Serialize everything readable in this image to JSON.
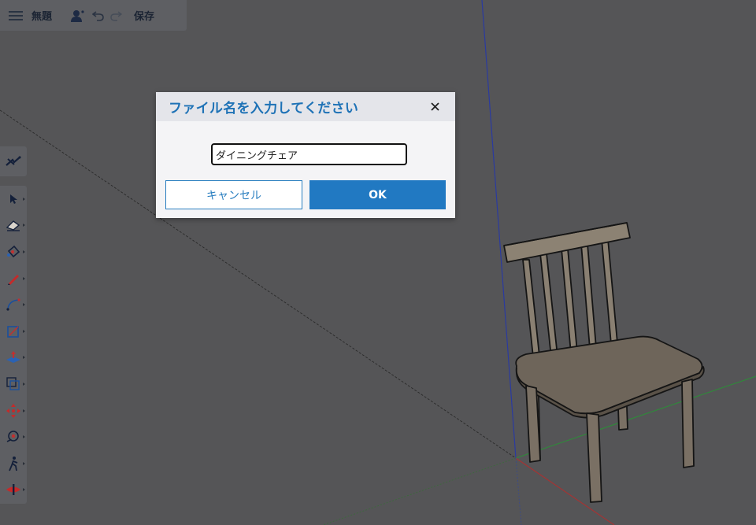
{
  "toolbar": {
    "menu_icon": "hamburger-menu-icon",
    "title": "無題",
    "user_icon": "user-icon",
    "undo_icon": "undo-icon",
    "redo_icon": "redo-icon",
    "save_label": "保存"
  },
  "left_toolbar": {
    "top_tool": "search-warehouse-icon",
    "tools": [
      "select-tool-icon",
      "eraser-tool-icon",
      "paint-bucket-tool-icon",
      "pencil-tool-icon",
      "arc-tool-icon",
      "rectangle-tool-icon",
      "push-pull-tool-icon",
      "offset-tool-icon",
      "move-tool-icon",
      "orbit-tool-icon",
      "walk-tool-icon",
      "section-plane-tool-icon"
    ]
  },
  "dialog": {
    "title": "ファイル名を入力してください",
    "filename_value": "ダイニングチェア",
    "cancel_label": "キャンセル",
    "ok_label": "OK"
  },
  "colors": {
    "accent": "#2179c2",
    "title": "#1e72b6",
    "viewport": "#555557"
  }
}
